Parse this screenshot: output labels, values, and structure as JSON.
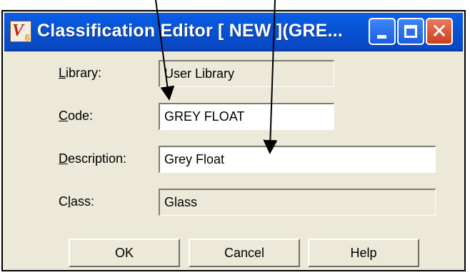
{
  "window": {
    "title": "Classification Editor  [ NEW ](GRE...",
    "app_icon_glyph": "V",
    "app_icon_sub": "6",
    "title_bar_color": "#0753d2"
  },
  "titlebar_buttons": {
    "minimize_icon": "minimize-icon",
    "maximize_icon": "maximize-icon",
    "close_glyph": "✕"
  },
  "form": {
    "library": {
      "label_mnemonic": "L",
      "label_rest": "ibrary:",
      "value": "User Library"
    },
    "code": {
      "label_mnemonic": "C",
      "label_rest": "ode:",
      "value": "GREY FLOAT"
    },
    "description": {
      "label_mnemonic": "D",
      "label_rest": "escription:",
      "value": "Grey Float"
    },
    "class": {
      "label_pre": "C",
      "label_mnemonic": "l",
      "label_rest": "ass:",
      "value": "Glass"
    }
  },
  "buttons": {
    "ok": "OK",
    "cancel": "Cancel",
    "help": "Help"
  }
}
